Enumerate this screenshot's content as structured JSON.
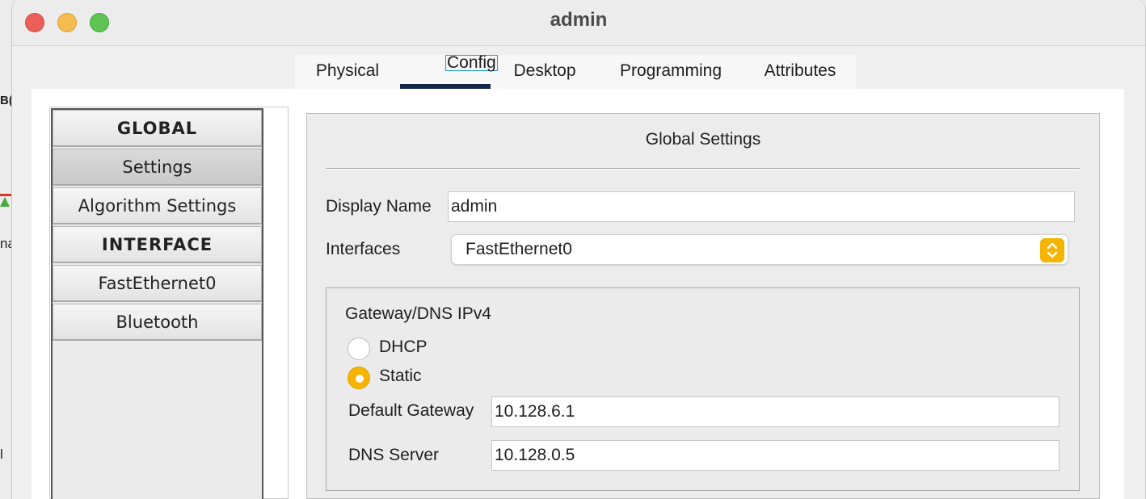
{
  "window": {
    "title": "admin"
  },
  "tabs": [
    {
      "label": "Physical"
    },
    {
      "label": "Config",
      "selected": true
    },
    {
      "label": "Desktop"
    },
    {
      "label": "Programming"
    },
    {
      "label": "Attributes"
    }
  ],
  "nav": {
    "items": [
      {
        "label": "GLOBAL",
        "type": "header"
      },
      {
        "label": "Settings",
        "selected": true
      },
      {
        "label": "Algorithm Settings"
      },
      {
        "label": "INTERFACE",
        "type": "header"
      },
      {
        "label": "FastEthernet0"
      },
      {
        "label": "Bluetooth"
      }
    ]
  },
  "settings": {
    "title": "Global Settings",
    "display_name_label": "Display Name",
    "display_name_value": "admin",
    "interfaces_label": "Interfaces",
    "interfaces_value": "FastEthernet0",
    "gateway_group_title": "Gateway/DNS IPv4",
    "dhcp_label": "DHCP",
    "static_label": "Static",
    "mode_selected": "Static",
    "default_gateway_label": "Default Gateway",
    "default_gateway_value": "10.128.6.1",
    "dns_server_label": "DNS Server",
    "dns_server_value": "10.128.0.5"
  },
  "colors": {
    "accent": "#f4b400",
    "tab_underline": "#13274a",
    "focus_outline": "#1aa3d6",
    "close_button": "#ec5f58",
    "minimize_button": "#f5bd4f",
    "zoom_button": "#5fc453"
  },
  "background_fragments": {
    "left_top": "B(",
    "left_mid": "na",
    "left_bottom": "l"
  }
}
